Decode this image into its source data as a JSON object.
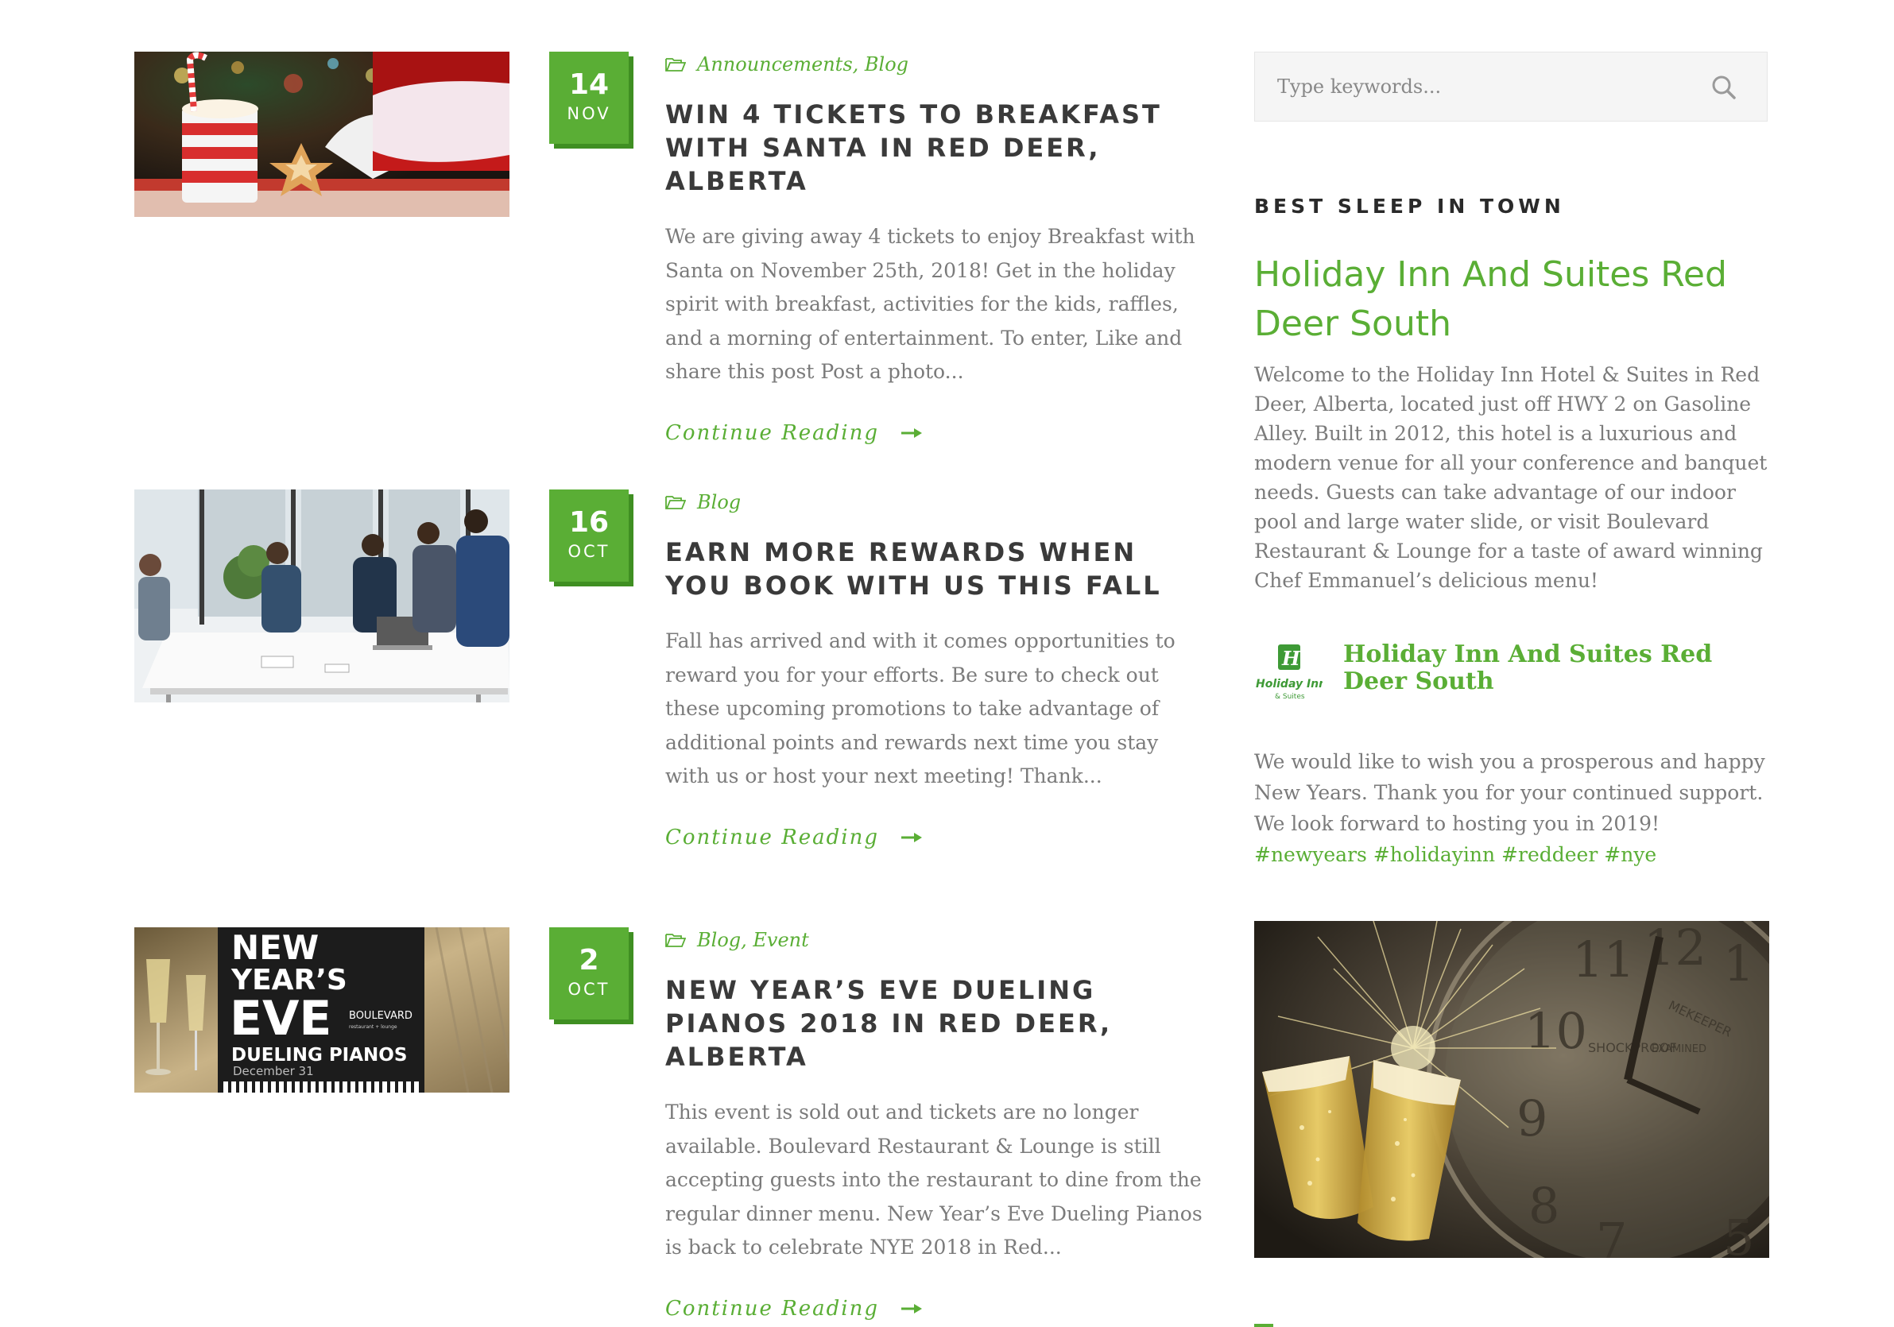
{
  "colors": {
    "accent": "#5aae35",
    "accent_dark": "#3f8f22",
    "title": "#3a3a3a",
    "text": "#7b7b7b"
  },
  "icons": {
    "category": "folder-open-icon",
    "read_more": "arrow-right-icon",
    "search": "search-icon"
  },
  "posts": [
    {
      "day": "14",
      "month": "NOV",
      "categories": "Announcements, Blog",
      "title": "WIN 4 TICKETS TO BREAKFAST WITH SANTA IN RED DEER, ALBERTA",
      "excerpt": "We are giving away 4 tickets to enjoy Breakfast with Santa on November 25th, 2018! Get in the holiday spirit with breakfast, activities for the kids, raffles, and a morning of entertainment. To enter, Like and share this post Post a photo...",
      "read_more": "Continue Reading"
    },
    {
      "day": "16",
      "month": "OCT",
      "categories": "Blog",
      "title": "EARN MORE REWARDS WHEN YOU BOOK WITH US THIS FALL",
      "excerpt": "Fall has arrived and with it comes opportunities to reward you for your efforts. Be sure to check out these upcoming promotions to take advantage of additional points and rewards next time you stay with us or host your next meeting! Thank...",
      "read_more": "Continue Reading"
    },
    {
      "day": "2",
      "month": "OCT",
      "categories": "Blog, Event",
      "title": "NEW YEAR’S EVE DUELING PIANOS 2018 IN RED DEER, ALBERTA",
      "excerpt": "This event is sold out and tickets are no longer available. Boulevard Restaurant & Lounge is still accepting guests into the restaurant to dine from the regular dinner menu. New Year’s Eve Dueling Pianos is back to celebrate NYE 2018 in Red...",
      "read_more": "Continue Reading",
      "image_text": {
        "line1": "NEW",
        "line2": "YEAR’S",
        "line3": "EVE",
        "line4": "DUELING PIANOS",
        "line5": "December 31",
        "brand": "BOULEVARD",
        "brand_sub": "restaurant + lounge"
      }
    }
  ],
  "sidebar": {
    "search_placeholder": "Type keywords...",
    "widget_title": "BEST SLEEP IN TOWN",
    "hotel_name": "Holiday Inn And Suites Red Deer South",
    "about": "Welcome to the Holiday Inn Hotel & Suites in Red Deer, Alberta, located just off HWY 2 on Gasoline Alley. Built in 2012, this hotel is a luxurious and modern venue for all your conference and banquet needs. Guests can take advantage of our indoor pool and large water slide, or visit Boulevard Restaurant & Lounge for a taste of award winning Chef Emmanuel’s delicious menu!",
    "fb_logo_text": "Holiday Inn",
    "fb_logo_sub": "& Suites",
    "fb_name": "Holiday Inn And Suites Red Deer South",
    "fb_text": "We would like to wish you a prosperous and happy New Years. Thank you for your continued support. We look forward to hosting you in 2019!",
    "fb_tags": "#newyears #holidayinn #reddeer #nye",
    "fb_image_text": "SHOCKPROOF",
    "fb_image_text2": "MEKEEPER",
    "fb_image_text3": "EXAMINED"
  }
}
